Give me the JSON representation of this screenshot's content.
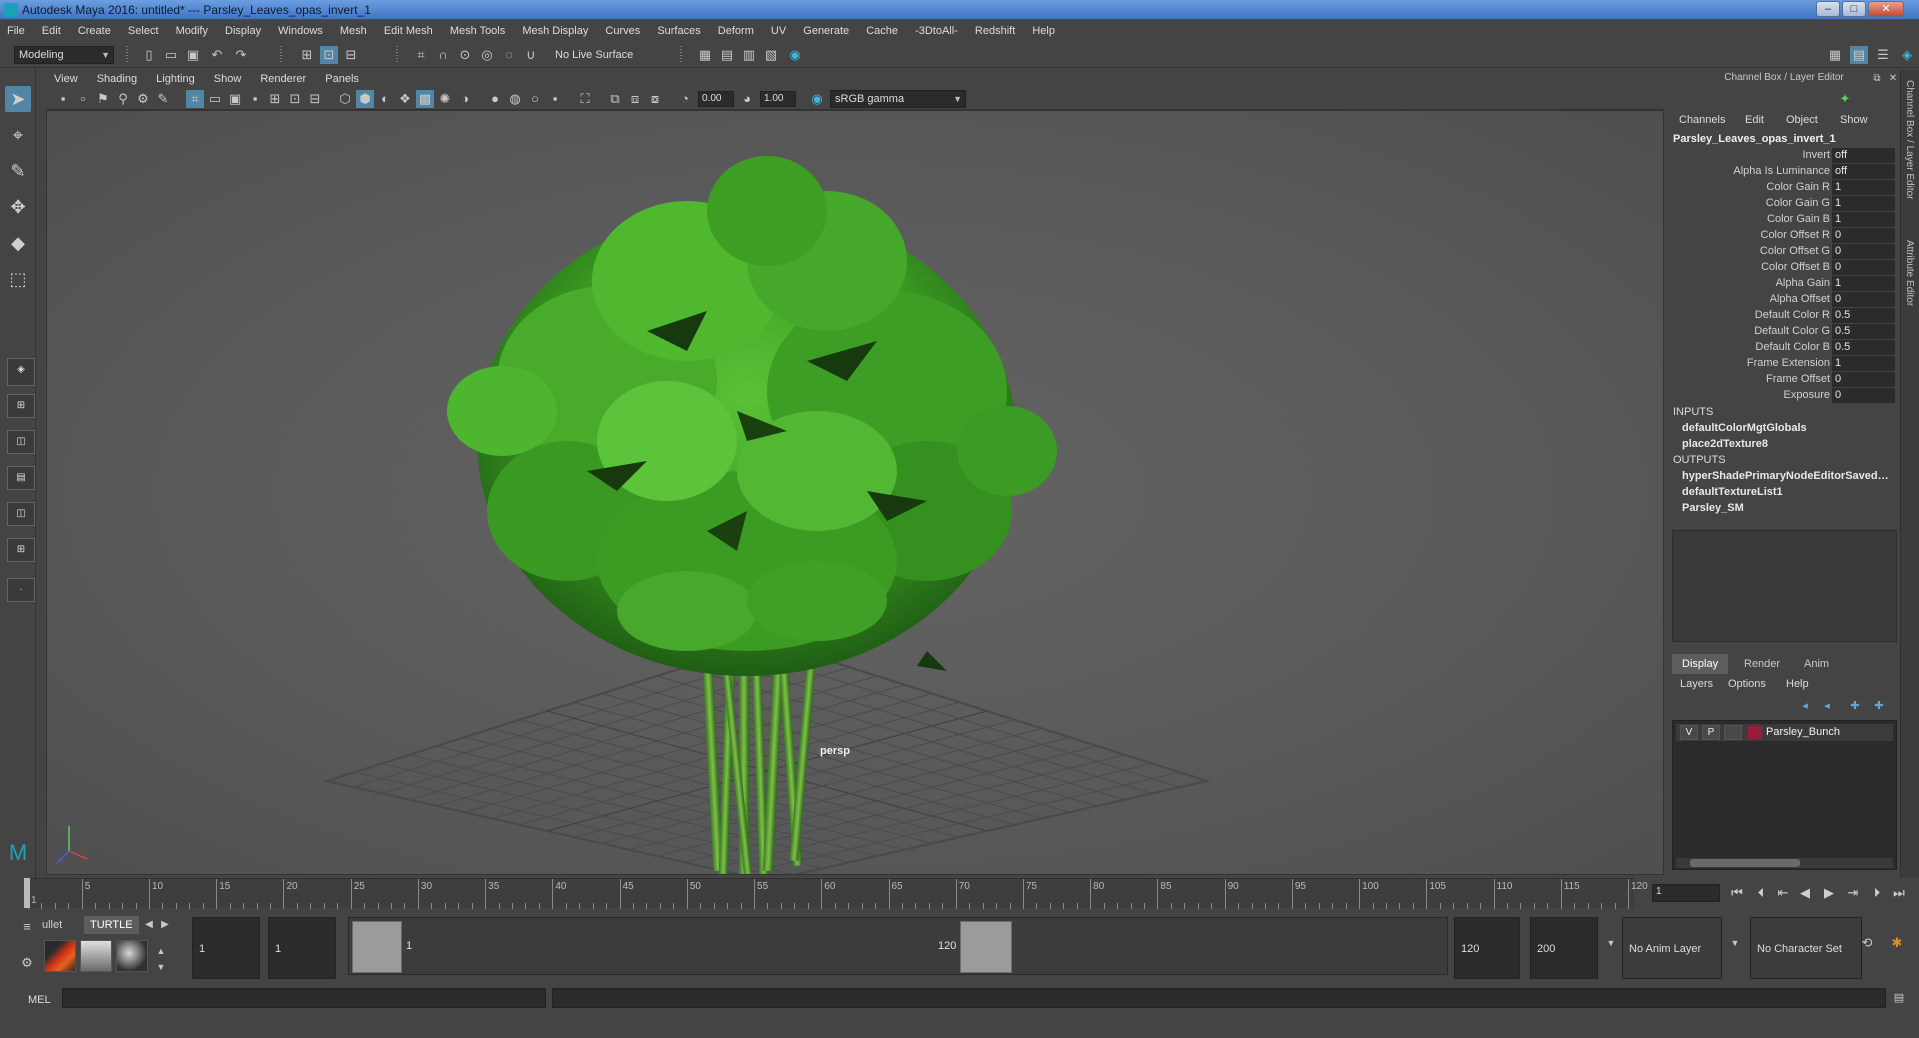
{
  "window": {
    "title": "Autodesk Maya 2016: untitled*   ---   Parsley_Leaves_opas_invert_1"
  },
  "menubar": [
    "File",
    "Edit",
    "Create",
    "Select",
    "Modify",
    "Display",
    "Windows",
    "Mesh",
    "Edit Mesh",
    "Mesh Tools",
    "Mesh Display",
    "Curves",
    "Surfaces",
    "Deform",
    "UV",
    "Generate",
    "Cache",
    "-3DtoAll-",
    "Redshift",
    "Help"
  ],
  "status": {
    "mode": "Modeling",
    "live_surface": "No Live Surface"
  },
  "viewport": {
    "menus": [
      "View",
      "Shading",
      "Lighting",
      "Show",
      "Renderer",
      "Panels"
    ],
    "exposure": "0.00",
    "gamma": "1.00",
    "color_space": "sRGB gamma",
    "camera_label": "persp"
  },
  "channel_box": {
    "title": "Channel Box / Layer Editor",
    "menus": [
      "Channels",
      "Edit",
      "Object",
      "Show"
    ],
    "node": "Parsley_Leaves_opas_invert_1",
    "attributes": [
      {
        "label": "Invert",
        "value": "off"
      },
      {
        "label": "Alpha Is Luminance",
        "value": "off"
      },
      {
        "label": "Color Gain R",
        "value": "1"
      },
      {
        "label": "Color Gain G",
        "value": "1"
      },
      {
        "label": "Color Gain B",
        "value": "1"
      },
      {
        "label": "Color Offset R",
        "value": "0"
      },
      {
        "label": "Color Offset G",
        "value": "0"
      },
      {
        "label": "Color Offset B",
        "value": "0"
      },
      {
        "label": "Alpha Gain",
        "value": "1"
      },
      {
        "label": "Alpha Offset",
        "value": "0"
      },
      {
        "label": "Default Color R",
        "value": "0.5"
      },
      {
        "label": "Default Color G",
        "value": "0.5"
      },
      {
        "label": "Default Color B",
        "value": "0.5"
      },
      {
        "label": "Frame Extension",
        "value": "1"
      },
      {
        "label": "Frame Offset",
        "value": "0"
      },
      {
        "label": "Exposure",
        "value": "0"
      }
    ],
    "inputs_label": "INPUTS",
    "inputs": [
      "defaultColorMgtGlobals",
      "place2dTexture8"
    ],
    "outputs_label": "OUTPUTS",
    "outputs": [
      "hyperShadePrimaryNodeEditorSavedTabsInfo",
      "defaultTextureList1",
      "Parsley_SM"
    ]
  },
  "layer_editor": {
    "tabs": [
      "Display",
      "Render",
      "Anim"
    ],
    "menus": [
      "Layers",
      "Options",
      "Help"
    ],
    "layer": {
      "v": "V",
      "p": "P",
      "name": "Parsley_Bunch",
      "color": "#9b1c3a"
    }
  },
  "side_tabs": [
    "Channel Box / Layer Editor",
    "Attribute Editor"
  ],
  "timeline": {
    "labels": [
      "1",
      "5",
      "10",
      "15",
      "20",
      "25",
      "30",
      "35",
      "40",
      "45",
      "50",
      "55",
      "60",
      "65",
      "70",
      "75",
      "80",
      "85",
      "90",
      "95",
      "100",
      "105",
      "110",
      "115",
      "120"
    ],
    "current_frame": "1"
  },
  "range": {
    "start": "1",
    "playback_start": "1",
    "handle_start": "1",
    "handle_end": "120",
    "playback_end": "120",
    "end": "200",
    "anim_layer": "No Anim Layer",
    "character_set": "No Character Set"
  },
  "shelf": {
    "tabs": [
      "ullet",
      "TURTLE"
    ]
  },
  "command_line": {
    "lang": "MEL",
    "value": ""
  },
  "colors": {
    "viewport_bg": "#595959",
    "panel_bg": "#444444",
    "selection": "#5285a6",
    "leaf_green": "#3f9a24"
  }
}
